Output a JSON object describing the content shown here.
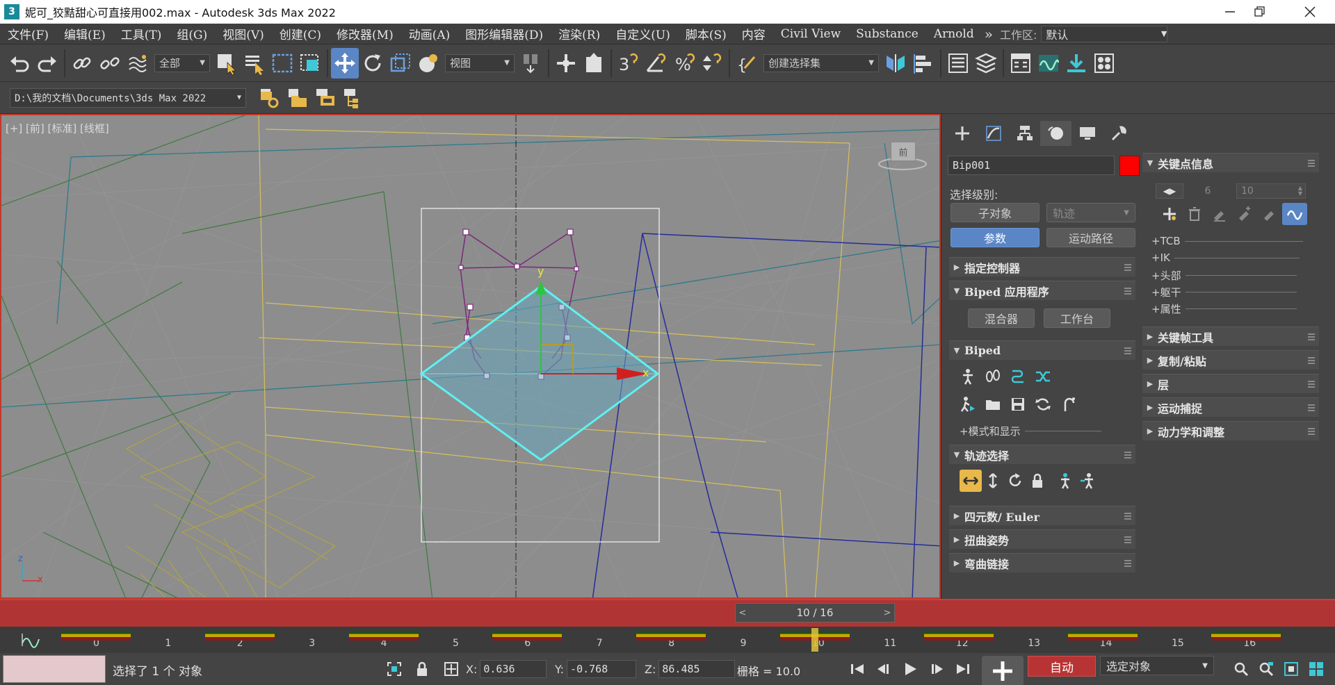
{
  "window": {
    "title": "妮可_狡黠甜心可直接用002.max - Autodesk 3ds Max 2022",
    "app_icon": "3",
    "controls": [
      "minimize",
      "restore",
      "close"
    ]
  },
  "menu": {
    "items": [
      "文件(F)",
      "编辑(E)",
      "工具(T)",
      "组(G)",
      "视图(V)",
      "创建(C)",
      "修改器(M)",
      "动画(A)",
      "图形编辑器(D)",
      "渲染(R)",
      "自定义(U)",
      "脚本(S)",
      "内容",
      "Civil View",
      "Substance",
      "Arnold"
    ],
    "overflow": "»",
    "workspace_label": "工作区:",
    "workspace_value": "默认"
  },
  "toolbar": {
    "selection_filter": "全部",
    "ref_coord": "视图",
    "named_selection": "创建选择集"
  },
  "toolbar2": {
    "project_path": "D:\\我的文档\\Documents\\3ds Max 2022"
  },
  "viewport": {
    "label": "[+] [前] [标准] [线框]",
    "viewcube_label": "前",
    "axis_y": "y",
    "axis_x": "x",
    "triad_z": "z",
    "triad_x": "x"
  },
  "command_panel": {
    "object_name": "Bip001",
    "object_color": "#ff0000",
    "selection_level_label": "选择级别:",
    "btn_subobject": "子对象",
    "btn_trajectory": "轨迹",
    "btn_params": "参数",
    "btn_motion_path": "运动路径",
    "rollout_assign_controller": "指定控制器",
    "rollout_biped_apps": "Biped 应用程序",
    "btn_mixer": "混合器",
    "btn_workbench": "工作台",
    "rollout_biped": "Biped",
    "mode_display": "+模式和显示",
    "rollout_track_selection": "轨迹选择",
    "rollout_quaternion": "四元数/ Euler",
    "rollout_twist_poses": "扭曲姿势",
    "rollout_bend_links": "弯曲链接",
    "key_info": "关键点信息",
    "key_number": "6",
    "key_time": "10",
    "plus_tcb": "+TCB",
    "plus_ik": "+IK",
    "plus_head": "+头部",
    "plus_body": "+躯干",
    "plus_props": "+属性",
    "keyframe_tools": "关键帧工具",
    "copy_paste": "复制/粘贴",
    "layers": "层",
    "motion_capture": "运动捕捉",
    "dynamics": "动力学和调整"
  },
  "timeline": {
    "current_frame": 10,
    "total_frames": 16,
    "slider_text": "10 / 16",
    "ticks": [
      "0",
      "1",
      "2",
      "3",
      "4",
      "5",
      "6",
      "7",
      "8",
      "9",
      "10",
      "11",
      "12",
      "13",
      "14",
      "15",
      "16"
    ],
    "key_frames": [
      0,
      2,
      4,
      6,
      8,
      10,
      12,
      14,
      16
    ]
  },
  "status": {
    "selection_text": "选择了 1 个 对象",
    "x_label": "X:",
    "x_value": "0.636",
    "y_label": "Y:",
    "y_value": "-0.768",
    "z_label": "Z:",
    "z_value": "86.485",
    "grid_text": "栅格 = 10.0",
    "auto_key": "自动",
    "key_set": "选定对象"
  },
  "colors": {
    "active_tool": "#5b86c5",
    "timeline_red": "#b03434",
    "selection_cyan": "#5ff0f0"
  }
}
